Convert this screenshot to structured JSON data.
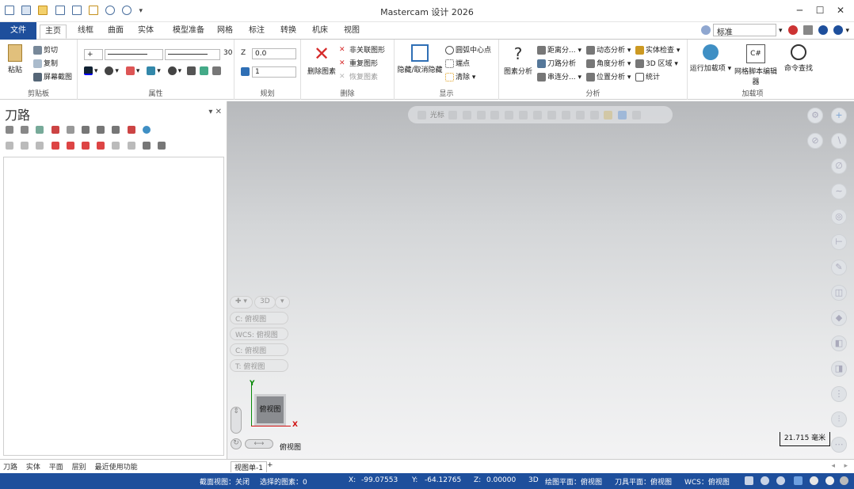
{
  "app": {
    "title": "Mastercam 设计 2026",
    "window_controls": [
      "─",
      "☐",
      "✕"
    ]
  },
  "colors": {
    "accent": "#1e4f9c",
    "status_bg": "#1e4f9c",
    "delete_red": "#d62b2b"
  },
  "tabs": [
    {
      "label": "文件"
    },
    {
      "label": "主页"
    },
    {
      "label": "线框"
    },
    {
      "label": "曲面"
    },
    {
      "label": "实体"
    },
    {
      "label": "模型准备"
    },
    {
      "label": "网格"
    },
    {
      "label": "标注"
    },
    {
      "label": "转换"
    },
    {
      "label": "机床"
    },
    {
      "label": "视图"
    }
  ],
  "right_controls": {
    "standard_select": "标准"
  },
  "ribbon": {
    "clipboard": {
      "label": "剪贴板",
      "paste": "粘贴",
      "cut": "剪切",
      "copy": "复制",
      "screenshot": "屏幕截图"
    },
    "attributes": {
      "label": "属性",
      "line_style": "+",
      "thickness": "30"
    },
    "organize": {
      "label": "规划",
      "z_label": "Z",
      "z_value": "0.0",
      "level_value": "1"
    },
    "delete": {
      "label": "删除",
      "delete_entities": "删除图素",
      "unrelated": "非关联图形",
      "duplicate": "重复图形",
      "undelete": "恢复图素"
    },
    "display": {
      "label": "显示",
      "hide_unhide": "隐藏/取消隐藏",
      "arc_center": "圆弧中心点",
      "endpoints": "端点",
      "clear_color": "清除"
    },
    "analyze": {
      "label": "分析",
      "entity_analysis": "图素分析",
      "distance": "距离分...",
      "toolpath": "刀路分析",
      "chain": "串连分...",
      "dynamic": "动态分析",
      "angle": "角度分析",
      "position": "位置分析",
      "solid_check": "实体检查",
      "3d_area": "3D 区域",
      "statistics": "统计"
    },
    "addins": {
      "label": "加载项",
      "run_addin": "运行加载项",
      "script_editor": "网格脚本编辑器",
      "command_finder": "命令查找"
    }
  },
  "panel": {
    "title": "刀路",
    "controls": "▾ ✕",
    "tabs": [
      "刀路",
      "实体",
      "平面",
      "层别",
      "最近使用功能"
    ]
  },
  "viewport": {
    "toolbar_label": "光标",
    "plane_items": [
      "C: 俯视图",
      "WCS: 俯视图",
      "C: 俯视图",
      "T: 俯视图"
    ],
    "mode_3d": "3D",
    "cube_label": "俯视图",
    "axis_x": "X",
    "axis_y": "Y",
    "view_label": "俯视图",
    "scale": "21.715 毫米"
  },
  "viewsheet": {
    "tab": "视图单-1",
    "add": "+"
  },
  "status": {
    "section_view": "截面视图：关闭",
    "selected": "选择的图素：0",
    "x_label": "X:",
    "x_value": "-99.07553",
    "y_label": "Y:",
    "y_value": "-64.12765",
    "z_label": "Z:",
    "z_value": "0.00000",
    "mode": "3D",
    "cplane": "绘图平面：俯视图",
    "tplane": "刀具平面：俯视图",
    "wcs": "WCS：俯视图"
  }
}
